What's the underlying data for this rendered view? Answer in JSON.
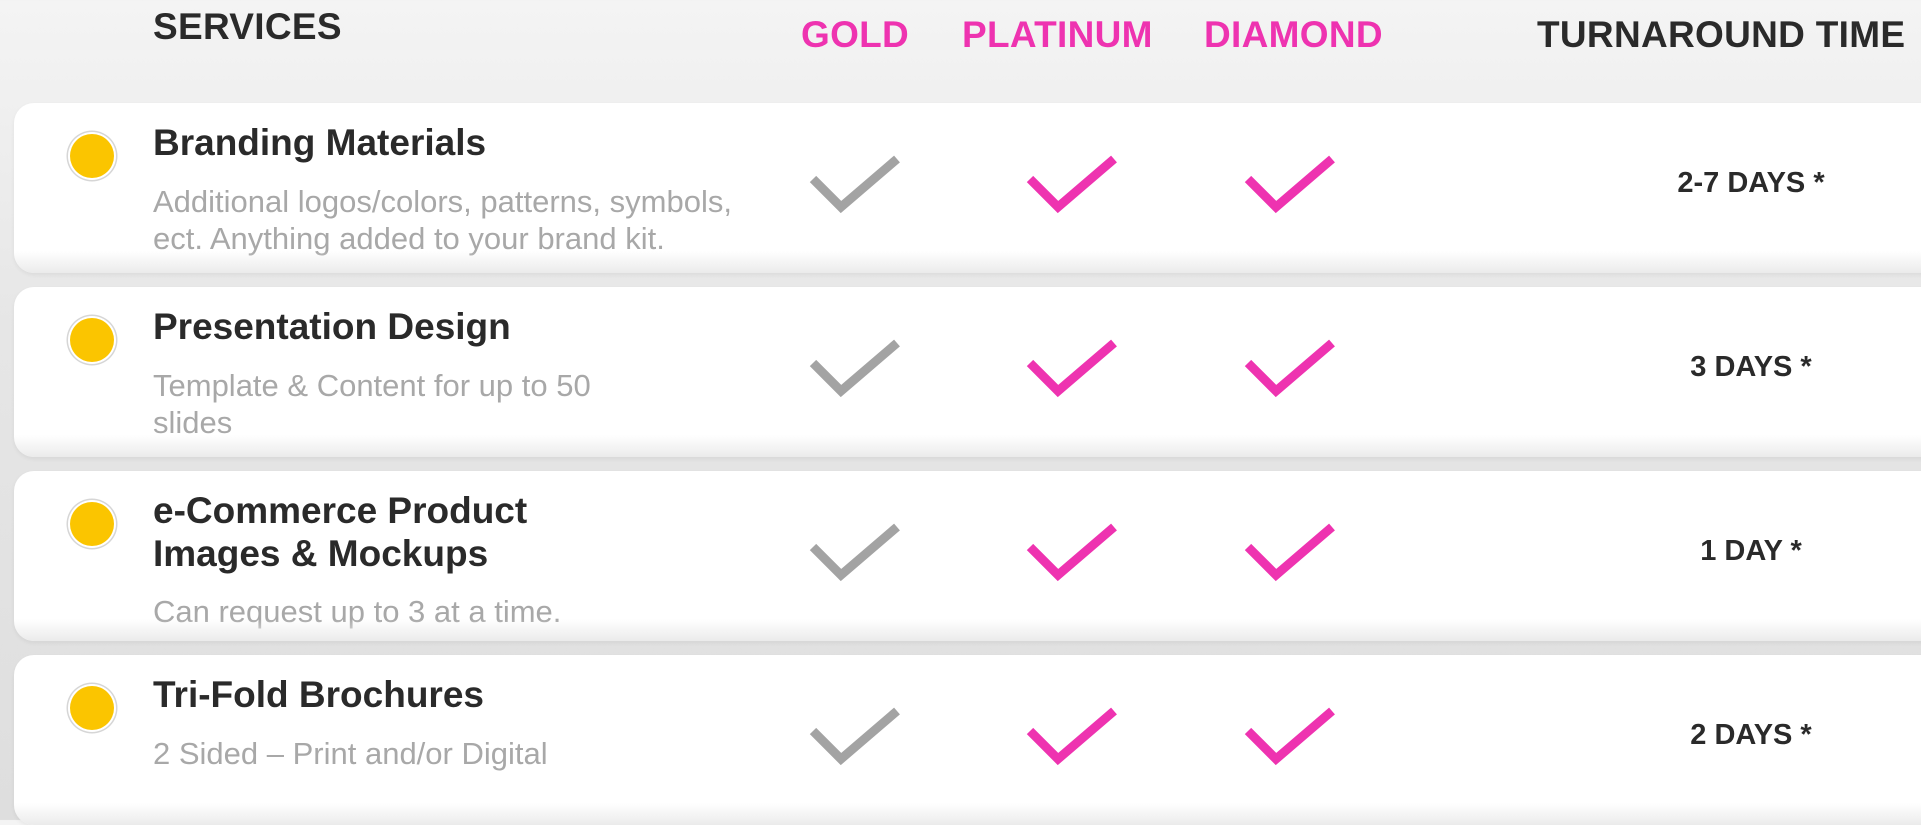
{
  "header": {
    "services": "SERVICES",
    "gold": "GOLD",
    "platinum": "PLATINUM",
    "diamond": "DIAMOND",
    "turnaround": "TURNAROUND TIME"
  },
  "colors": {
    "accent_pink": "#ee33b0",
    "gold_check": "#a3a3a3",
    "bullet_yellow": "#fbc500"
  },
  "rows": [
    {
      "title_lines": [
        "Branding Materials"
      ],
      "desc_lines": [
        "Additional logos/colors, patterns, symbols,",
        "ect. Anything added to your brand kit."
      ],
      "turnaround": "2-7 DAYS *",
      "gold": true,
      "platinum": true,
      "diamond": true
    },
    {
      "title_lines": [
        "Presentation Design"
      ],
      "desc_lines": [
        "Template & Content for up to 50",
        "slides"
      ],
      "turnaround": "3 DAYS *",
      "gold": true,
      "platinum": true,
      "diamond": true
    },
    {
      "title_lines": [
        "e-Commerce Product",
        "Images & Mockups"
      ],
      "desc_lines": [
        "Can request up to 3 at a time."
      ],
      "turnaround": "1 DAY *",
      "gold": true,
      "platinum": true,
      "diamond": true
    },
    {
      "title_lines": [
        "Tri-Fold Brochures"
      ],
      "desc_lines": [
        "2 Sided – Print and/or Digital"
      ],
      "turnaround": "2 DAYS *",
      "gold": true,
      "platinum": true,
      "diamond": true
    }
  ]
}
